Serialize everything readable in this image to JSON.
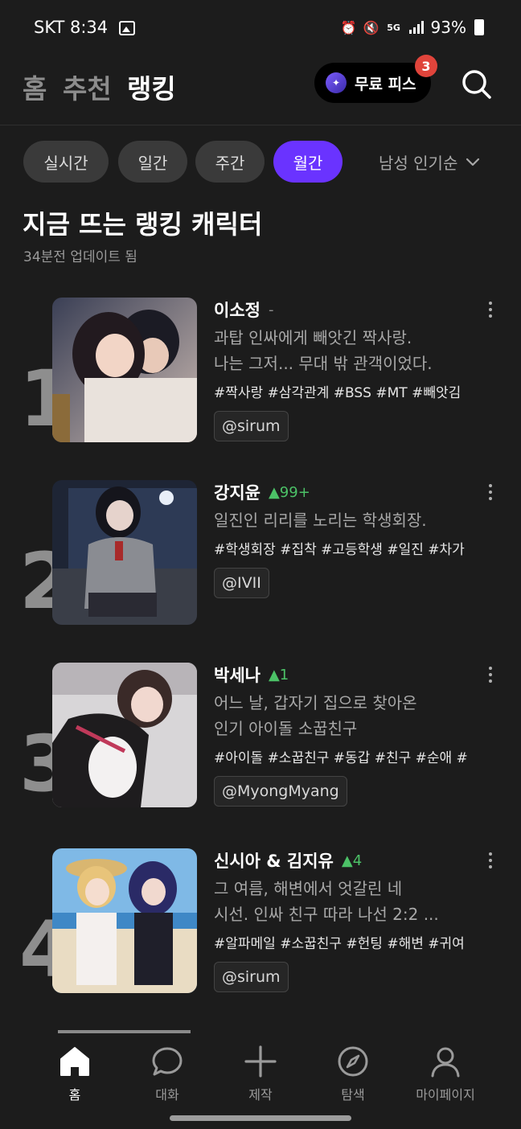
{
  "status_bar": {
    "carrier_time": "SKT 8:34",
    "battery": "93%",
    "network": "5G",
    "icons": [
      "gallery-icon",
      "alarm-icon",
      "mute-icon",
      "network-5g-icon",
      "signal-icon",
      "battery-icon"
    ]
  },
  "top_nav": {
    "tabs": [
      "홈",
      "추천",
      "랭킹"
    ],
    "active_tab": "랭킹",
    "free_pass_label": "무료 피스",
    "free_pass_badge": "3"
  },
  "period_tabs": {
    "items": [
      "실시간",
      "일간",
      "주간",
      "월간"
    ],
    "active": "월간",
    "filter_label": "남성 인기순"
  },
  "section": {
    "title": "지금 뜨는 랭킹 캐릭터",
    "subtitle": "34분전 업데이트 됨"
  },
  "rankings": [
    {
      "rank": "1",
      "name": "이소정",
      "change": "-",
      "description": "과탑 인싸에게 빼앗긴 짝사랑.\n나는 그저... 무대 밖 관객이었다.",
      "tags": "#짝사랑 #삼각관계 #BSS #MT #빼앗김",
      "creator": "@sirum"
    },
    {
      "rank": "2",
      "name": "강지윤",
      "change": "▲99+",
      "description": "일진인 리리를 노리는 학생회장.",
      "tags": "#학생회장 #집착 #고등학생 #일진 #차가",
      "creator": "@IVII"
    },
    {
      "rank": "3",
      "name": "박세나",
      "change": "▲1",
      "description": "어느 날, 갑자기 집으로 찾아온\n인기 아이돌 소꿉친구",
      "tags": "#아이돌 #소꿉친구 #동갑 #친구 #순애 #",
      "creator": "@MyongMyang"
    },
    {
      "rank": "4",
      "name": "신시아 & 김지유",
      "change": "▲4",
      "description": "그 여름, 해변에서 엇갈린 네\n시선. 인싸 친구 따라 나선 2:2 ...",
      "tags": "#알파메일 #소꿉친구 #헌팅 #해변 #귀여",
      "creator": "@sirum"
    }
  ],
  "bottom_nav": {
    "items": [
      {
        "label": "홈",
        "icon": "home-icon"
      },
      {
        "label": "대화",
        "icon": "chat-icon"
      },
      {
        "label": "제작",
        "icon": "plus-icon"
      },
      {
        "label": "탐색",
        "icon": "compass-icon"
      },
      {
        "label": "마이페이지",
        "icon": "profile-icon"
      }
    ],
    "active": "홈"
  },
  "colors": {
    "background": "#1c1c1c",
    "accent": "#6a33ff",
    "badge": "#e0443b",
    "rank_up": "#4cc267"
  }
}
